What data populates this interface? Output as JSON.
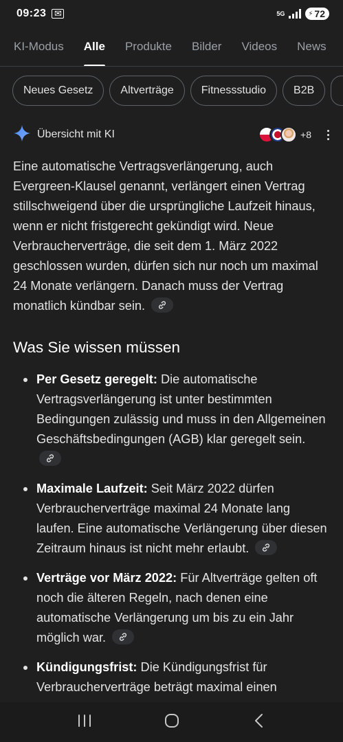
{
  "status_bar": {
    "time": "09:23",
    "network": "5G",
    "battery": "72"
  },
  "tabs": [
    {
      "label": "KI-Modus",
      "active": false
    },
    {
      "label": "Alle",
      "active": true
    },
    {
      "label": "Produkte",
      "active": false
    },
    {
      "label": "Bilder",
      "active": false
    },
    {
      "label": "Videos",
      "active": false
    },
    {
      "label": "News",
      "active": false
    }
  ],
  "chips": [
    "Neues Gesetz",
    "Altverträge",
    "Fitnessstudio",
    "B2B"
  ],
  "ai_overview": {
    "title": "Übersicht mit KI",
    "sources_more": "+8",
    "intro": "Eine automatische Vertragsverlängerung, auch Evergreen-Klausel genannt, verlängert einen Vertrag stillschweigend über die ursprüngliche Laufzeit hinaus, wenn er nicht fristgerecht gekündigt wird. Neue Verbraucherverträge, die seit dem 1. März 2022 geschlossen wurden, dürfen sich nur noch um maximal 24 Monate verlängern. Danach muss der Vertrag monatlich kündbar sein.",
    "heading": "Was Sie wissen müssen",
    "bullets": [
      {
        "term": "Per Gesetz geregelt:",
        "text": " Die automatische Vertragsverlängerung ist unter bestimmten Bedingungen zulässig und muss in den Allgemeinen Geschäftsbedingungen (AGB) klar geregelt sein."
      },
      {
        "term": "Maximale Laufzeit:",
        "text": " Seit März 2022 dürfen Verbraucherverträge maximal 24 Monate lang laufen. Eine automatische Verlängerung über diesen Zeitraum hinaus ist nicht mehr erlaubt."
      },
      {
        "term": "Verträge vor März 2022:",
        "text": " Für Altverträge gelten oft noch die älteren Regeln, nach denen eine automatische Verlängerung um bis zu ein Jahr möglich war."
      },
      {
        "term": "Kündigungsfrist:",
        "text": " Die Kündigungsfrist für Verbraucherverträge beträgt maximal einen"
      }
    ]
  },
  "colors": {
    "background": "#1f1f1f",
    "text": "#e3e3e3",
    "gemini_blue": "#4c8df6"
  }
}
